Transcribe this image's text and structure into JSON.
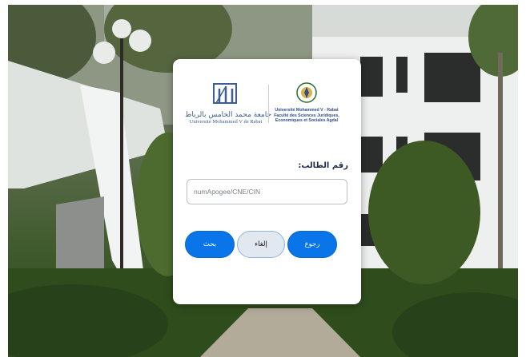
{
  "background": {
    "description_color": "#3f5a2c"
  },
  "logos": {
    "left": {
      "icon": "um5-university-logo-icon",
      "arabic_name": "جامعة محمد الخامس بالرباط",
      "latin_name": "Université Mohammed V de Rabat"
    },
    "right": {
      "icon": "fsjes-agdal-emblem-icon",
      "line1": "Université Mohammed V - Rabat",
      "line2": "Faculté des Sciences Juridiques,",
      "line3": "Economiques et Sociales   Agdal"
    }
  },
  "form": {
    "label": "رقم الطالب:",
    "input_placeholder": "numApogee/CNE/CIN",
    "input_value": ""
  },
  "buttons": {
    "search": "بحث",
    "cancel": "إلغاء",
    "back": "رجوع"
  },
  "colors": {
    "primary": "#0a74e9",
    "secondary": "#e2e8ef",
    "logo_text": "#3c5f8f"
  }
}
